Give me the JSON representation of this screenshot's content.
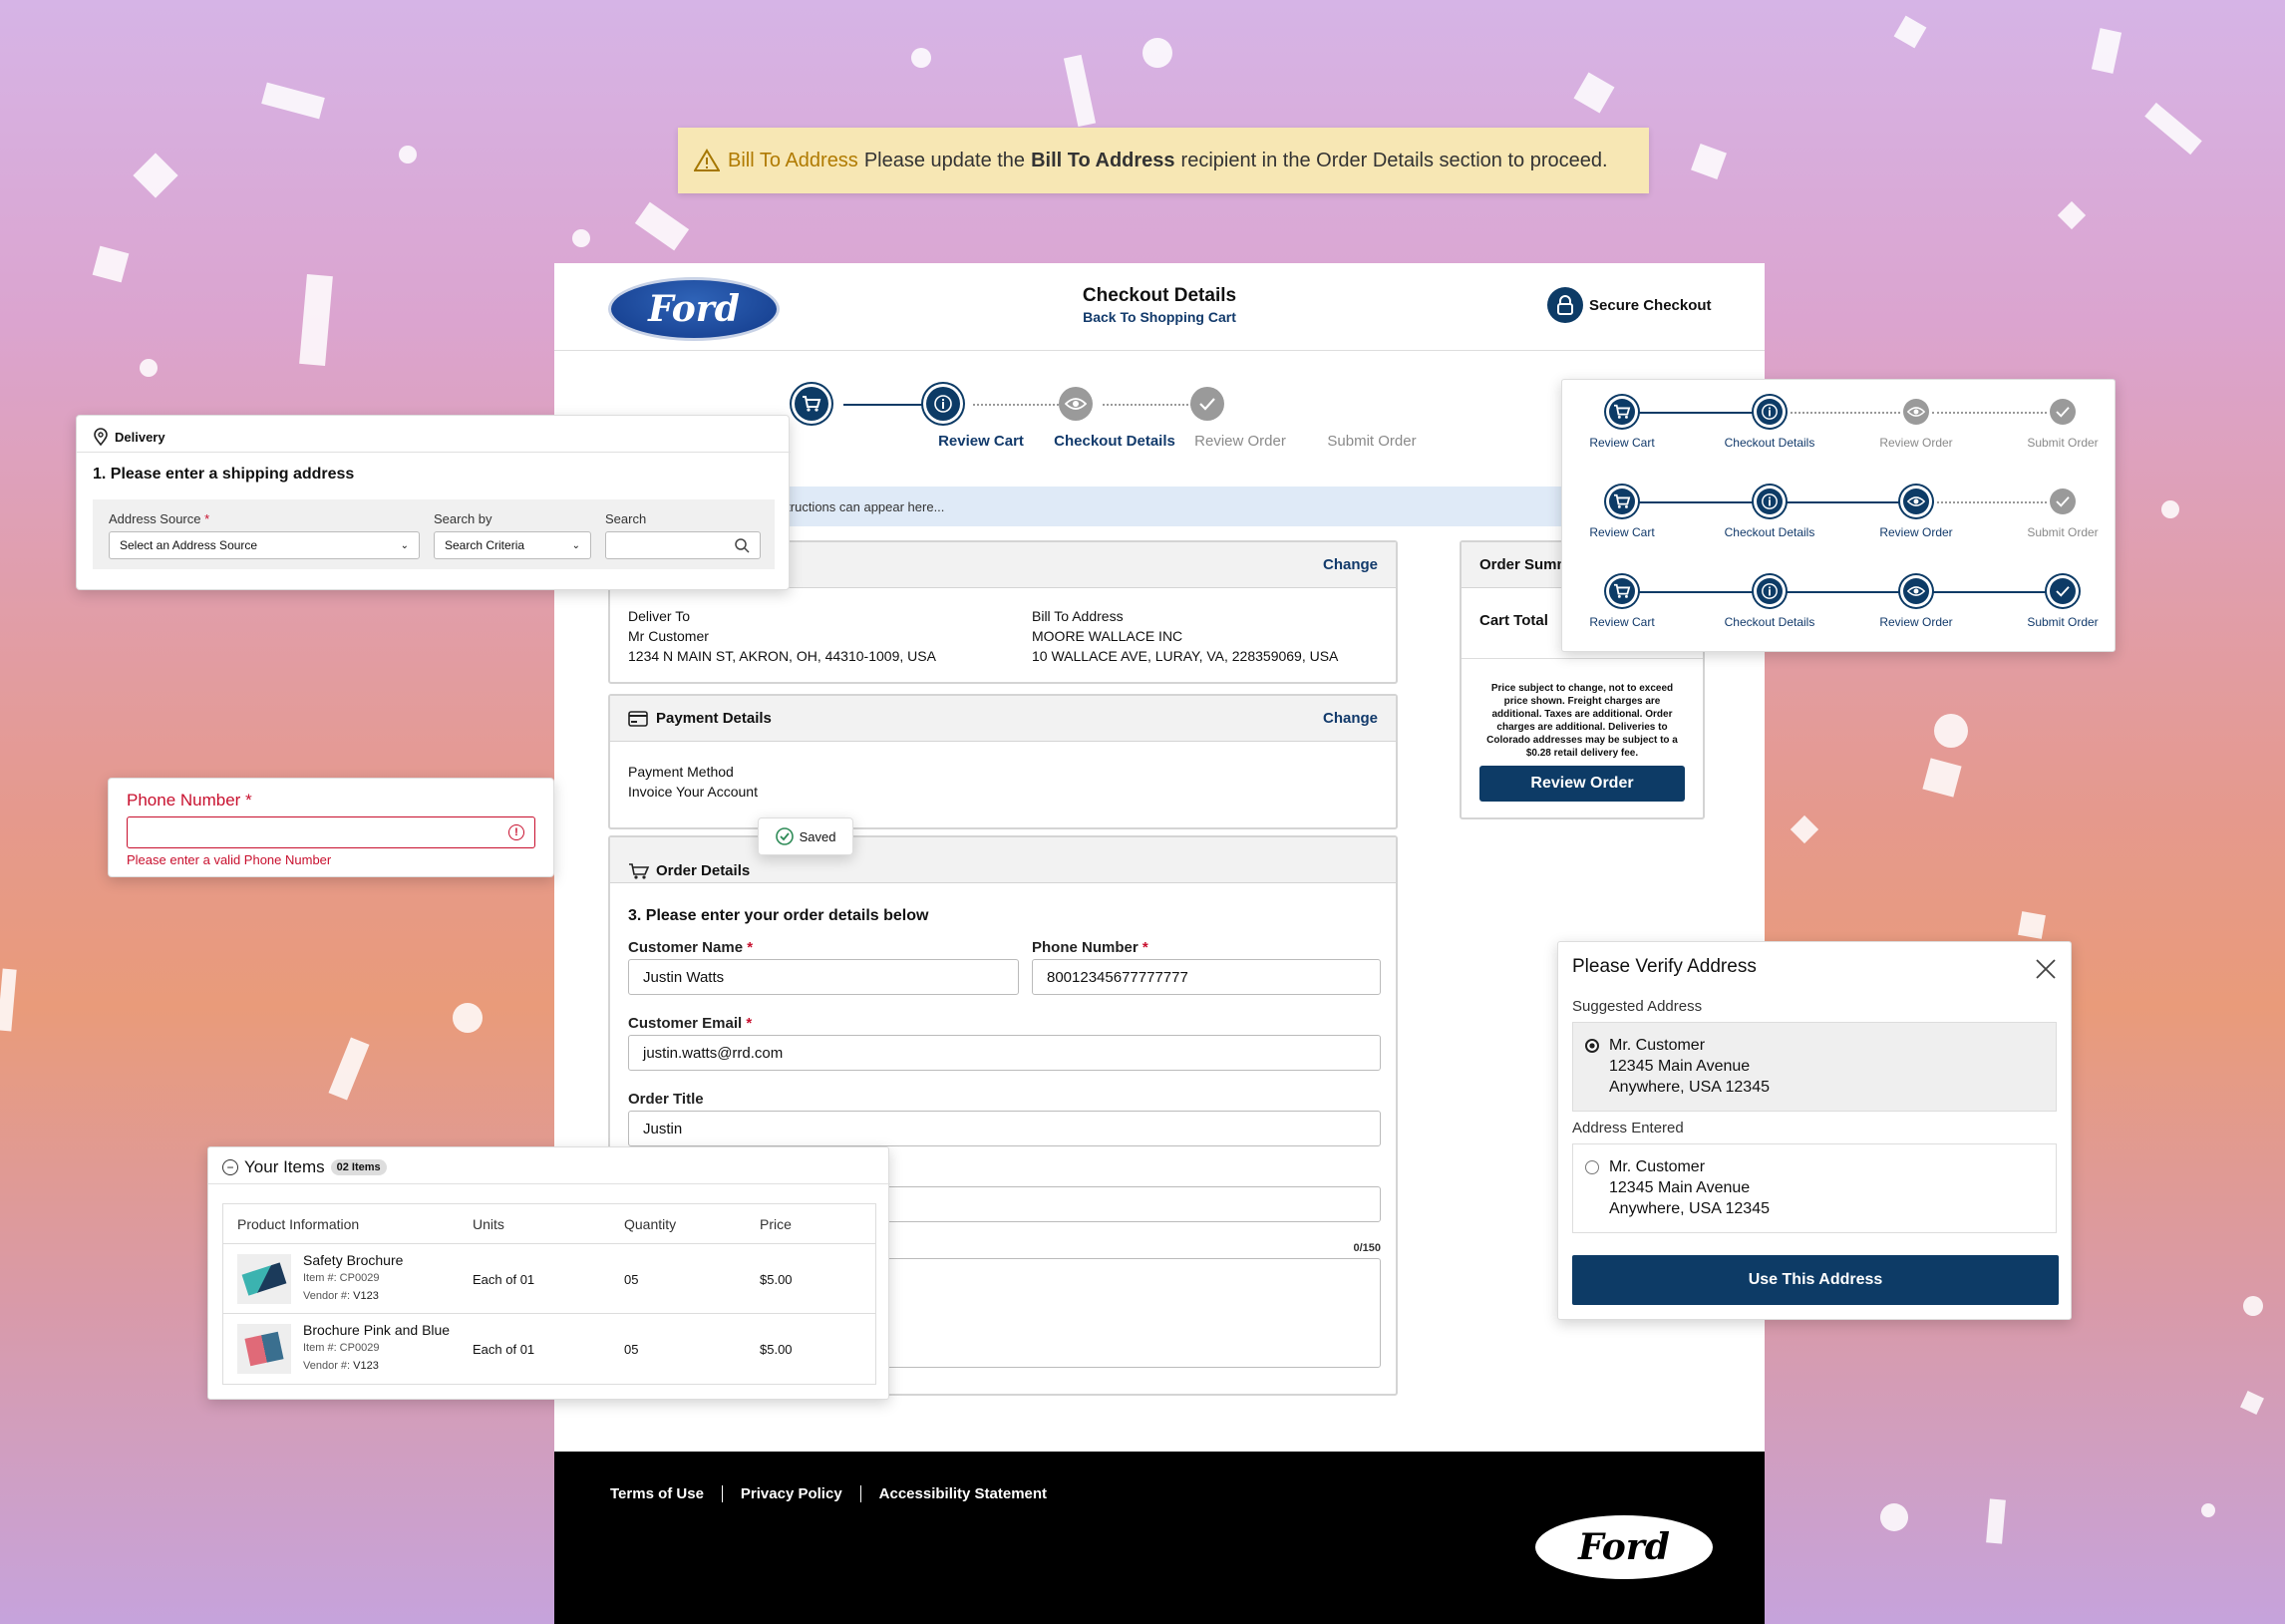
{
  "alert": {
    "title": "Bill To Address",
    "message_prefix": "Please update the",
    "message_bold": "Bill To Address",
    "message_suffix": "recipient in the Order Details section to proceed."
  },
  "header": {
    "logo": "Ford",
    "title": "Checkout Details",
    "back_link": "Back To Shopping Cart",
    "secure": "Secure Checkout"
  },
  "steps": [
    {
      "label": "Review Cart",
      "icon": "cart-icon"
    },
    {
      "label": "Checkout Details",
      "icon": "info-icon"
    },
    {
      "label": "Review Order",
      "icon": "eye-icon"
    },
    {
      "label": "Submit Order",
      "icon": "check-icon"
    }
  ],
  "instructions": "page instructions can appear here...",
  "address_section": {
    "change": "Change",
    "deliver_label": "Deliver To",
    "deliver_name": "Mr Customer",
    "deliver_address": "1234 N MAIN ST, AKRON, OH, 44310-1009, USA",
    "bill_label": "Bill To Address",
    "bill_name": "MOORE WALLACE INC",
    "bill_address": "10 WALLACE AVE, LURAY, VA, 228359069, USA"
  },
  "payment": {
    "title": "Payment Details",
    "change": "Change",
    "method_label": "Payment Method",
    "method_value": "Invoice Your Account"
  },
  "saved_toast": "Saved",
  "order_details": {
    "title": "Order Details",
    "heading": "3. Please enter your order details below",
    "customer_name_label": "Customer Name",
    "customer_name": "Justin Watts",
    "phone_label": "Phone Number",
    "phone": "80012345677777777",
    "email_label": "Customer Email",
    "email": "justin.watts@rrd.com",
    "order_title_label": "Order Title",
    "order_title": "Justin",
    "char_count": "0/150"
  },
  "summary": {
    "title": "Order Summ",
    "cart_total_label": "Cart Total",
    "disclaimer": "Price subject to change, not to exceed price shown. Freight charges are additional. Taxes are additional. Order charges are additional. Deliveries to Colorado addresses may be subject to a $0.28 retail delivery fee.",
    "button": "Review Order"
  },
  "footer": {
    "links": [
      "Terms of Use",
      "Privacy Policy",
      "Accessibility Statement"
    ],
    "logo": "Ford"
  },
  "delivery_card": {
    "tag": "Delivery",
    "heading": "1. Please enter a shipping address",
    "source_label": "Address Source",
    "source_value": "Select an Address Source",
    "search_by_label": "Search by",
    "search_by_value": "Search Criteria",
    "search_label": "Search"
  },
  "phone_error_card": {
    "label": "Phone Number",
    "error": "Please enter a valid Phone Number"
  },
  "items_card": {
    "title": "Your Items",
    "badge": "02 Items",
    "columns": [
      "Product Information",
      "Units",
      "Quantity",
      "Price"
    ],
    "rows": [
      {
        "name": "Safety Brochure",
        "item": "Item #: CP0029",
        "vendor_label": "Vendor #:",
        "vendor": "V123",
        "units": "Each of 01",
        "qty": "05",
        "price": "$5.00"
      },
      {
        "name": "Brochure Pink and Blue",
        "item": "Item #: CP0029",
        "vendor_label": "Vendor #:",
        "vendor": "V123",
        "units": "Each of 01",
        "qty": "05",
        "price": "$5.00"
      }
    ]
  },
  "verify_card": {
    "title": "Please Verify Address",
    "suggested_label": "Suggested Address",
    "suggested": [
      "Mr. Customer",
      "12345 Main Avenue",
      "Anywhere, USA 12345"
    ],
    "entered_label": "Address Entered",
    "entered": [
      "Mr. Customer",
      "12345 Main Avenue",
      "Anywhere, USA 12345"
    ],
    "button": "Use This Address"
  },
  "stepper_card": {
    "labels": [
      "Review Cart",
      "Checkout Details",
      "Review Order",
      "Submit Order"
    ],
    "active_counts": [
      2,
      3,
      4
    ]
  },
  "colors": {
    "navy": "#0d3b66",
    "error": "#c8102e",
    "alert_bg": "#f7e7b4",
    "alert_title": "#b07a00"
  }
}
